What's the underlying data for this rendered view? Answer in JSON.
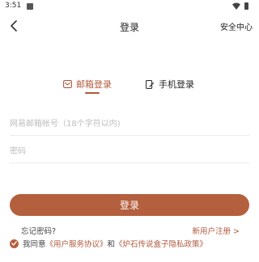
{
  "status_bar": {
    "time": "3:51"
  },
  "header": {
    "title": "登录",
    "right_label": "安全中心",
    "back_icon": "chevron-left-icon"
  },
  "tabs": [
    {
      "label": "邮箱登录",
      "icon": "mail-icon",
      "active": true
    },
    {
      "label": "手机登录",
      "icon": "phone-edit-icon",
      "active": false
    }
  ],
  "form": {
    "account_placeholder": "网易邮箱帐号（18个字符以内)",
    "password_placeholder": "密码",
    "login_label": "登录"
  },
  "links": {
    "forgot": "忘记密码?",
    "register": "新用户注册 >"
  },
  "agreement": {
    "prefix": "我同意",
    "terms": "《用户服务协议》",
    "and": "和",
    "privacy": "《炉石传说盒子隐私政策》"
  },
  "colors": {
    "accent": "#b45f3e",
    "accent_text": "#b05a3c"
  }
}
